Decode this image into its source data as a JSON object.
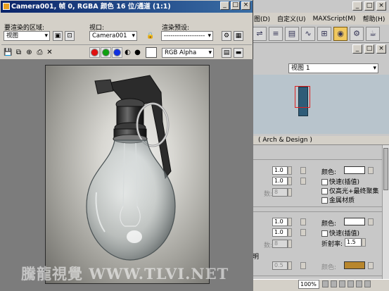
{
  "render_window": {
    "title": "Camera001, 帧 0, RGBA 颜色 16 位/通道 (1:1)",
    "area_label": "要渲染的区域:",
    "area_value": "视图",
    "viewport_label": "视口:",
    "viewport_value": "Camera001",
    "preset_label": "渲染预设:",
    "preset_value": "-------------------",
    "channel_display": "RGB Alpha",
    "channel_colors": {
      "red": "#e01010",
      "green": "#10a010",
      "blue": "#1030e0"
    }
  },
  "max": {
    "menu": [
      "图(D)",
      "自定义(U)",
      "MAXScript(M)",
      "帮助(H)"
    ],
    "viewport_label": "视图 1",
    "rollout_title": "( Arch & Design )",
    "panel_a": {
      "spin1": "1.0",
      "spin2": "1.0",
      "spin3": "8",
      "spin3_label": "数:",
      "color_label": "颜色:",
      "check1": "快速(插值)",
      "check2": "仅高光+最终聚集",
      "check3": "金属材质"
    },
    "panel_b": {
      "spin1": "1.0",
      "spin2": "1.0",
      "spin3": "8",
      "spin3_label": "数:",
      "color_label": "颜色:",
      "check1": "快速(插值)",
      "ior_label": "折射率:",
      "ior_value": "1.5",
      "section_label": "明",
      "spin4": "0.5",
      "color2_label": "颜色:"
    },
    "zoom": "100%"
  },
  "colors": {
    "titlebar": "#0a246a",
    "swatch_white": "#ffffff",
    "swatch_gold": "#b8862c",
    "selection_red": "#e02020"
  },
  "watermark": "騰龍視覺 WWW.TLVI.NET"
}
